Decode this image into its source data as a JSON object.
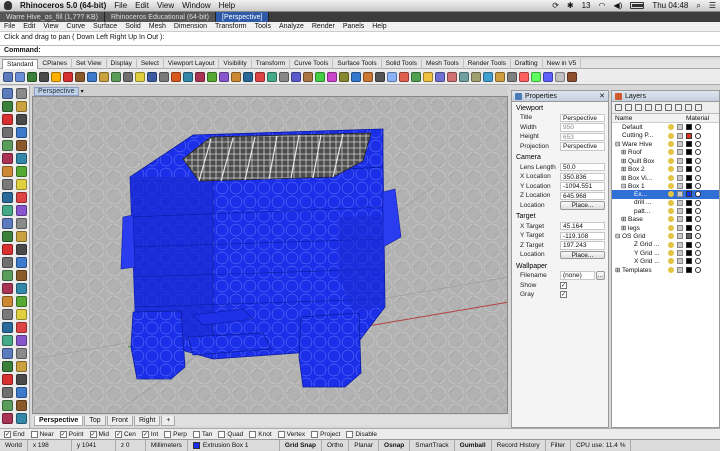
{
  "macbar": {
    "app": "Rhinoceros 5.0 (64-bit)",
    "menus": [
      "File",
      "Edit",
      "View",
      "Window",
      "Help"
    ],
    "right": [
      "13",
      "Thu 04:48"
    ]
  },
  "doctabs": [
    "Warre Hive_os_fill (1,7?? KB) - Rhinoceros Educational (64-bit) - [Perspective]"
  ],
  "doctab_split": [
    "Warre Hive_os_fill (1,7?? KB)",
    "Rhinoceros Educational (64-bit)",
    "[Perspective]"
  ],
  "menubar": [
    "File",
    "Edit",
    "View",
    "Curve",
    "Surface",
    "Solid",
    "Mesh",
    "Dimension",
    "Transform",
    "Tools",
    "Analyze",
    "Render",
    "Panels",
    "Help"
  ],
  "command": {
    "history": "Click and drag to pan ( Down  Left  Right  Up  In  Out ):",
    "label": "Command:",
    "value": ""
  },
  "toolbar_tabs": [
    "Standard",
    "CPlanes",
    "Set View",
    "Display",
    "Select",
    "Viewport Layout",
    "Visibility",
    "Transform",
    "Curve Tools",
    "Surface Tools",
    "Solid Tools",
    "Mesh Tools",
    "Render Tools",
    "Drafting",
    "New in V5"
  ],
  "toolbar_icon_colors": [
    "#5b7bbd",
    "#6b8fd6",
    "#3a7f3a",
    "#4a4a4a",
    "#ffb000",
    "#d83030",
    "#8b5a2b",
    "#3d7acc",
    "#c9a23f",
    "#5a9c5a",
    "#6f6f6f",
    "#e0d040",
    "#3b5ba0",
    "#7a7a7a",
    "#d85a20",
    "#3388aa",
    "#aa3355",
    "#55aa33",
    "#8855cc",
    "#cc8833",
    "#2a6a9a",
    "#dd4444",
    "#44aa88",
    "#888888",
    "#5a5acc",
    "#aa7744",
    "#44cc44",
    "#cc44cc",
    "#888833",
    "#3377cc",
    "#cc7733",
    "#555555",
    "#8ab4f8",
    "#e06050",
    "#50a050",
    "#f0c040",
    "#7070d0",
    "#d07070",
    "#70a0a0",
    "#a0a070",
    "#40a0d0",
    "#d0a040",
    "#808080",
    "#ff6060",
    "#60ff60",
    "#6060ff",
    "#c0c0c0",
    "#905030"
  ],
  "viewport": {
    "label": "Perspective"
  },
  "viewport_tabs": [
    "Perspective",
    "Top",
    "Front",
    "Right",
    "+"
  ],
  "properties": {
    "title": "Properties",
    "viewport_section": "Viewport",
    "viewport_rows": [
      {
        "k": "Title",
        "v": "Perspective",
        "dim": false
      },
      {
        "k": "Width",
        "v": "950",
        "dim": true
      },
      {
        "k": "Height",
        "v": "653",
        "dim": true
      },
      {
        "k": "Projection",
        "v": "Perspective",
        "dim": false
      }
    ],
    "camera_section": "Camera",
    "camera_rows": [
      {
        "k": "Lens Length",
        "v": "50.0"
      },
      {
        "k": "X Location",
        "v": "350.836"
      },
      {
        "k": "Y Location",
        "v": "-1094.551"
      },
      {
        "k": "Z Location",
        "v": "645.968"
      }
    ],
    "place_label": "Place...",
    "location_label": "Location",
    "target_section": "Target",
    "target_rows": [
      {
        "k": "X Target",
        "v": "45.164"
      },
      {
        "k": "Y Target",
        "v": "-119.108"
      },
      {
        "k": "Z Target",
        "v": "197.243"
      }
    ],
    "wallpaper_section": "Wallpaper",
    "filename_label": "Filename",
    "filename_value": "(none)",
    "browse_label": "...",
    "show_label": "Show",
    "gray_label": "Gray",
    "check_mark": "✓"
  },
  "layers": {
    "title": "Layers",
    "col_name": "Name",
    "col_material": "Material",
    "rows": [
      {
        "name": "Default",
        "indent": 0,
        "color": "#000000",
        "sel": false,
        "exp": ""
      },
      {
        "name": "Cutting P...",
        "indent": 0,
        "color": "#e03020",
        "sel": false,
        "exp": ""
      },
      {
        "name": "Ware Hive",
        "indent": 0,
        "color": "#000000",
        "sel": false,
        "exp": "⊟"
      },
      {
        "name": "Roof",
        "indent": 1,
        "color": "#000000",
        "sel": false,
        "exp": "⊞"
      },
      {
        "name": "Quilt Box",
        "indent": 1,
        "color": "#000000",
        "sel": false,
        "exp": "⊞"
      },
      {
        "name": "Box 2",
        "indent": 1,
        "color": "#000000",
        "sel": false,
        "exp": "⊞"
      },
      {
        "name": "Box Vi...",
        "indent": 1,
        "color": "#000000",
        "sel": false,
        "exp": "⊞"
      },
      {
        "name": "Box 1",
        "indent": 1,
        "color": "#000000",
        "sel": false,
        "exp": "⊟"
      },
      {
        "name": "Ex...",
        "indent": 2,
        "color": "#1a2cf0",
        "sel": true,
        "exp": ""
      },
      {
        "name": "drill ...",
        "indent": 2,
        "color": "#000000",
        "sel": false,
        "exp": ""
      },
      {
        "name": "patt...",
        "indent": 2,
        "color": "#000000",
        "sel": false,
        "exp": ""
      },
      {
        "name": "Base",
        "indent": 1,
        "color": "#000000",
        "sel": false,
        "exp": "⊞"
      },
      {
        "name": "legs",
        "indent": 1,
        "color": "#000000",
        "sel": false,
        "exp": "⊞"
      },
      {
        "name": "OS Grid",
        "indent": 0,
        "color": "#666666",
        "sel": false,
        "exp": "⊟"
      },
      {
        "name": "Z Grid ...",
        "indent": 2,
        "color": "#000000",
        "sel": false,
        "exp": ""
      },
      {
        "name": "Y Grid ...",
        "indent": 2,
        "color": "#000000",
        "sel": false,
        "exp": ""
      },
      {
        "name": "X Grid ...",
        "indent": 2,
        "color": "#000000",
        "sel": false,
        "exp": ""
      },
      {
        "name": "Templates",
        "indent": 0,
        "color": "#000000",
        "sel": false,
        "exp": "⊞"
      }
    ]
  },
  "osnaps": [
    {
      "label": "End",
      "checked": true
    },
    {
      "label": "Near",
      "checked": false
    },
    {
      "label": "Point",
      "checked": true
    },
    {
      "label": "Mid",
      "checked": true
    },
    {
      "label": "Cen",
      "checked": true
    },
    {
      "label": "Int",
      "checked": true
    },
    {
      "label": "Perp",
      "checked": false
    },
    {
      "label": "Tan",
      "checked": false
    },
    {
      "label": "Quad",
      "checked": false
    },
    {
      "label": "Knot",
      "checked": false
    },
    {
      "label": "Vertex",
      "checked": false
    },
    {
      "label": "Project",
      "checked": false
    },
    {
      "label": "Disable",
      "checked": false
    }
  ],
  "status": {
    "cplane": "World",
    "x": "x 198",
    "y": "y 1041",
    "z": "z 0",
    "units": "Millimeters",
    "layer": "Extrusion Box 1",
    "layer_color": "#1a2cf0",
    "toggles": [
      {
        "label": "Grid Snap",
        "bold": true
      },
      {
        "label": "Ortho",
        "bold": false
      },
      {
        "label": "Planar",
        "bold": false
      },
      {
        "label": "Osnap",
        "bold": true
      },
      {
        "label": "SmartTrack",
        "bold": false
      },
      {
        "label": "Gumball",
        "bold": true
      },
      {
        "label": "Record History",
        "bold": false
      },
      {
        "label": "Filter",
        "bold": false
      }
    ],
    "cpu": "CPU use: 11.4 %"
  }
}
